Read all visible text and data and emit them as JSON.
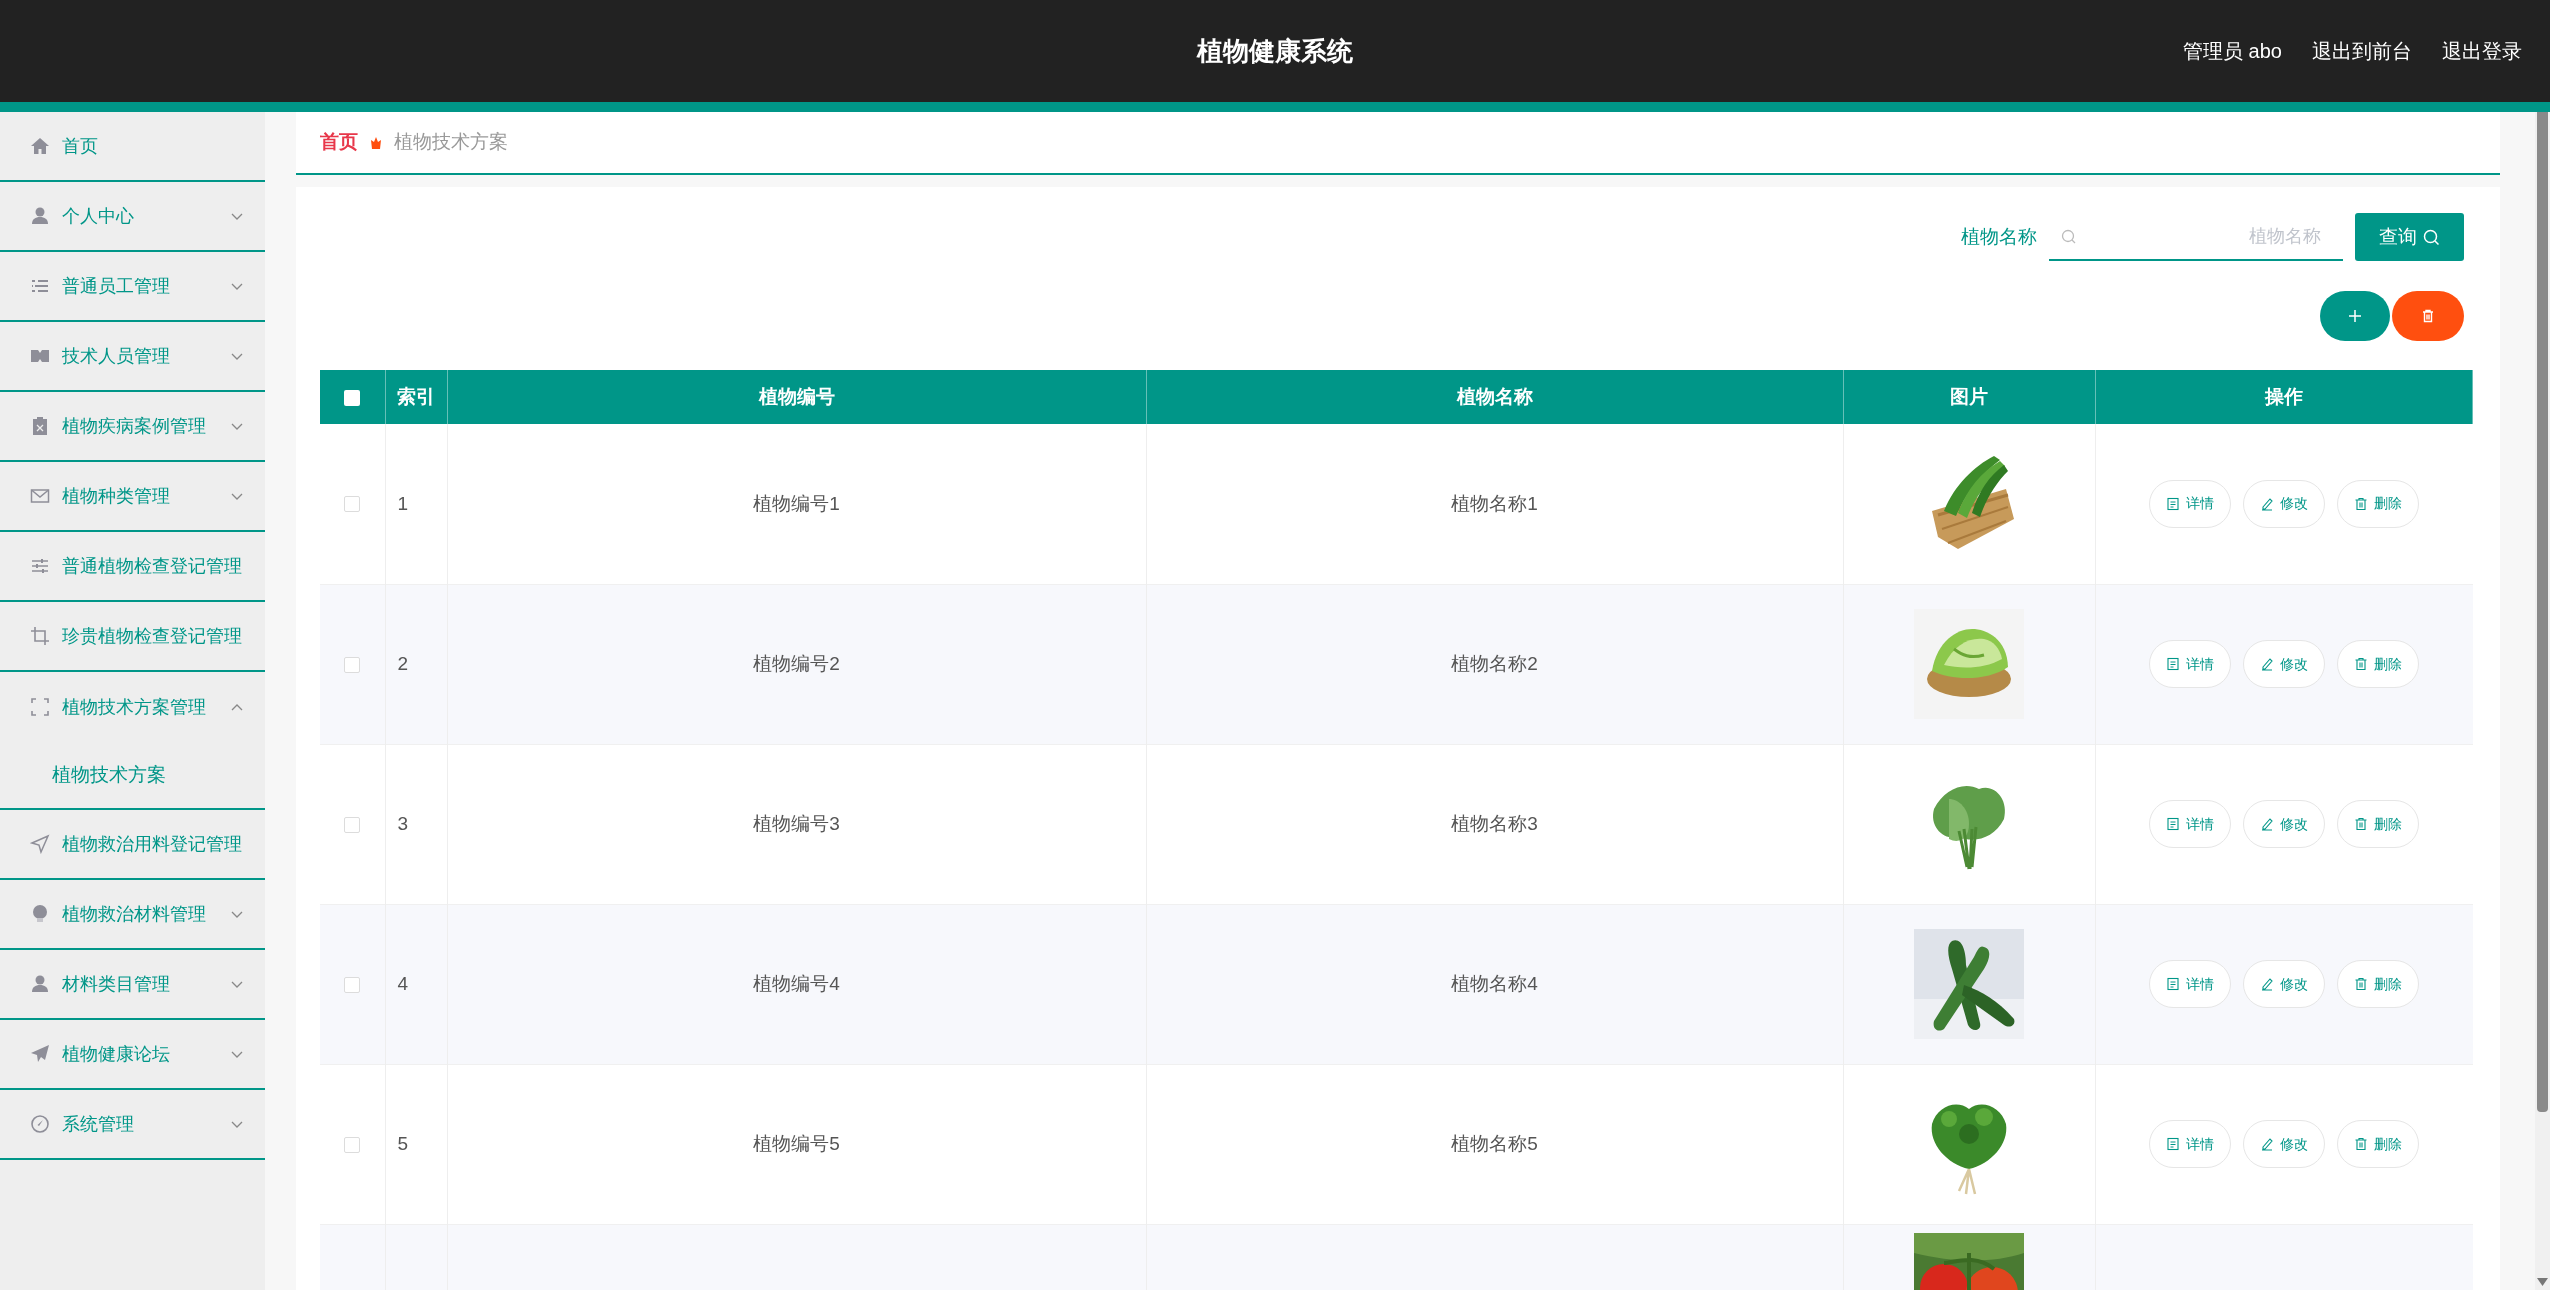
{
  "header": {
    "title": "植物健康系统",
    "user": "管理员 abo",
    "links": [
      "退出到前台",
      "退出登录"
    ]
  },
  "sidebar": {
    "items": [
      {
        "label": "首页"
      },
      {
        "label": "个人中心",
        "expanded": false
      },
      {
        "label": "普通员工管理",
        "expanded": false
      },
      {
        "label": "技术人员管理",
        "expanded": false
      },
      {
        "label": "植物疾病案例管理",
        "expanded": false
      },
      {
        "label": "植物种类管理",
        "expanded": false
      },
      {
        "label": "普通植物检查登记管理"
      },
      {
        "label": "珍贵植物检查登记管理"
      },
      {
        "label": "植物技术方案管理",
        "expanded": true,
        "children": [
          {
            "label": "植物技术方案"
          }
        ]
      },
      {
        "label": "植物救治用料登记管理"
      },
      {
        "label": "植物救治材料管理",
        "expanded": false
      },
      {
        "label": "材料类目管理",
        "expanded": false
      },
      {
        "label": "植物健康论坛",
        "expanded": false
      },
      {
        "label": "系统管理",
        "expanded": false
      }
    ]
  },
  "breadcrumb": [
    "首页",
    "植物技术方案"
  ],
  "search": {
    "label": "植物名称",
    "placeholder": "植物名称",
    "button": "查询"
  },
  "table": {
    "header_checked": false,
    "columns": [
      "索引",
      "植物编号",
      "植物名称",
      "图片",
      "操作"
    ],
    "rows": [
      {
        "checked": false,
        "index": "1",
        "code": "植物编号1",
        "name": "植物名称1",
        "picture": {
          "kind": "picture"
        },
        "actions": [
          "详情",
          "修改",
          "删除"
        ]
      },
      {
        "checked": false,
        "index": "2",
        "code": "植物编号2",
        "name": "植物名称2",
        "picture": {
          "kind": "picture"
        },
        "actions": [
          "详情",
          "修改",
          "删除"
        ]
      },
      {
        "checked": false,
        "index": "3",
        "code": "植物编号3",
        "name": "植物名称3",
        "picture": {
          "kind": "picture"
        },
        "actions": [
          "详情",
          "修改",
          "删除"
        ]
      },
      {
        "checked": false,
        "index": "4",
        "code": "植物编号4",
        "name": "植物名称4",
        "picture": {
          "kind": "picture"
        },
        "actions": [
          "详情",
          "修改",
          "删除"
        ]
      },
      {
        "checked": false,
        "index": "5",
        "code": "植物编号5",
        "name": "植物名称5",
        "picture": {
          "kind": "picture"
        },
        "actions": [
          "详情",
          "修改",
          "删除"
        ]
      },
      {
        "picture": {
          "kind": "picture"
        }
      }
    ]
  }
}
